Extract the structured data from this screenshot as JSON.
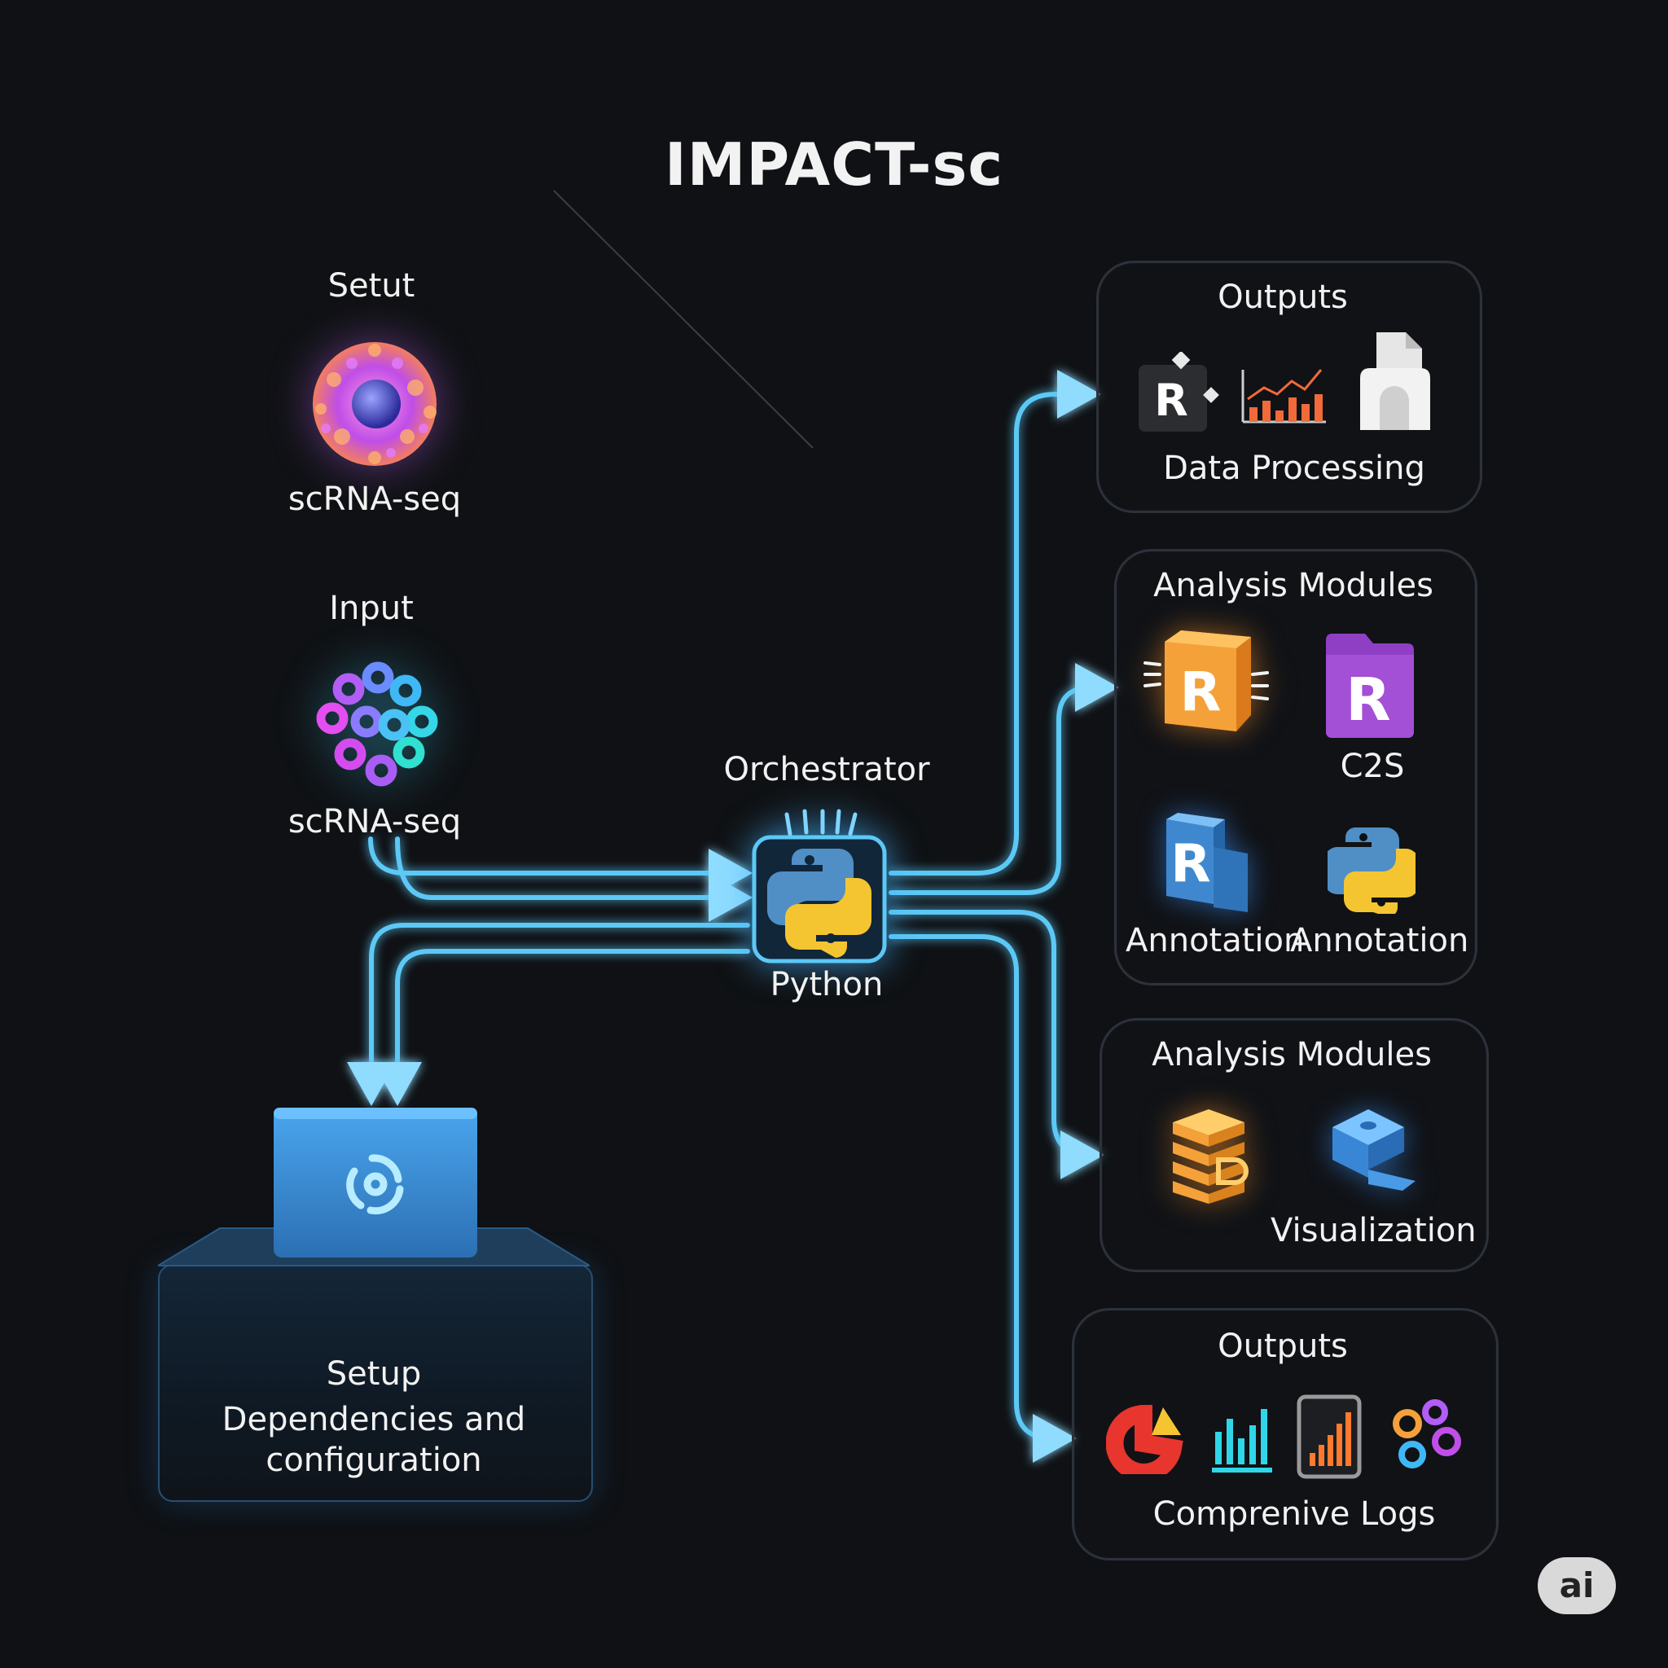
{
  "title": "IMPACT-sc",
  "left": {
    "top_cell": {
      "heading": "Setut",
      "caption": "scRNA-seq"
    },
    "input_cell": {
      "heading": "Input",
      "caption": "scRNA-seq"
    }
  },
  "orchestrator": {
    "heading": "Orchestrator",
    "caption": "Python"
  },
  "setup": {
    "heading": "Setup",
    "line1": "Dependencies and",
    "line2": "configuration"
  },
  "panels": {
    "outputs_top": {
      "title": "Outputs",
      "caption": "Data Processing"
    },
    "analysis_1": {
      "title": "Analysis Modules",
      "c2s_label": "C2S",
      "annot_left": "Annotation",
      "annot_right": "Annotation"
    },
    "analysis_2": {
      "title": "Analysis Modules",
      "vis_label": "Visualization"
    },
    "outputs_bottom": {
      "title": "Outputs",
      "caption": "Comprenive Logs"
    }
  },
  "icons": {
    "cell_top": "cell-icon",
    "cell_input": "cell-cluster-icon",
    "python": "python-chip-icon",
    "setup": "setup-cube-icon",
    "r_logo": "r-icon",
    "chart": "bar-chart-icon",
    "document": "document-stack-icon",
    "r_chip": "r-chip-icon",
    "r_purple": "r-file-icon",
    "r_blue": "r-cube-icon",
    "python_small": "python-icon",
    "database": "database-icon",
    "block_3d": "3d-block-icon",
    "pie": "pie-chart-icon",
    "bars_cyan": "bars-icon",
    "tablet": "tablet-chart-icon",
    "hexes": "hexagons-icon"
  },
  "badge": "ai",
  "colors": {
    "wire": "#5cc8f5",
    "background": "#0f1114",
    "panel_border": "#2c323b",
    "setup_blue": "#3a8fd9"
  }
}
